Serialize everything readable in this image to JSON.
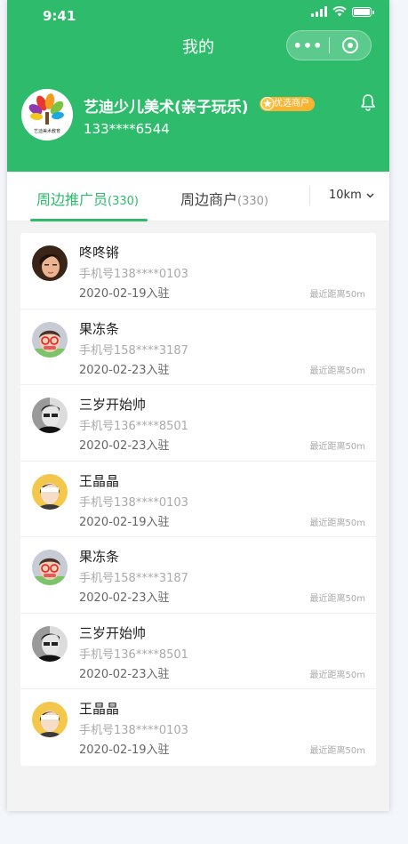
{
  "status_bar": {
    "time": "9:41"
  },
  "nav": {
    "title": "我的",
    "more_icon": "ellipsis-icon",
    "close_icon": "target-icon"
  },
  "merchant": {
    "name": "艺迪少儿美术(亲子玩乐)",
    "badge": "优选商户",
    "phone": "133****6544",
    "logo_caption": "艺迪美术教育"
  },
  "tabs": [
    {
      "label": "周边推广员",
      "count": "(330)",
      "active": true
    },
    {
      "label": "周边商户",
      "count": "(330)",
      "active": false
    }
  ],
  "distance_filter": {
    "value": "10km"
  },
  "promoters": [
    {
      "name": "咚咚锵",
      "phone": "手机号138****0103",
      "date": "2020-02-19入驻",
      "distance": "最近距离50m",
      "avatar": "avatar-brown"
    },
    {
      "name": "果冻条",
      "phone": "手机号158****3187",
      "date": "2020-02-23入驻",
      "distance": "最近距离50m",
      "avatar": "avatar-glasses"
    },
    {
      "name": "三岁开始帅",
      "phone": "手机号136****8501",
      "date": "2020-02-23入驻",
      "distance": "最近距离50m",
      "avatar": "avatar-bw"
    },
    {
      "name": "王晶晶",
      "phone": "手机号138****0103",
      "date": "2020-02-19入驻",
      "distance": "最近距离50m",
      "avatar": "avatar-yellow"
    },
    {
      "name": "果冻条",
      "phone": "手机号158****3187",
      "date": "2020-02-23入驻",
      "distance": "最近距离50m",
      "avatar": "avatar-glasses"
    },
    {
      "name": "三岁开始帅",
      "phone": "手机号136****8501",
      "date": "2020-02-23入驻",
      "distance": "最近距离50m",
      "avatar": "avatar-bw"
    },
    {
      "name": "王晶晶",
      "phone": "手机号138****0103",
      "date": "2020-02-19入驻",
      "distance": "最近距离50m",
      "avatar": "avatar-yellow"
    }
  ],
  "colors": {
    "brand": "#2ebb6c",
    "badge": "#f5b432"
  }
}
